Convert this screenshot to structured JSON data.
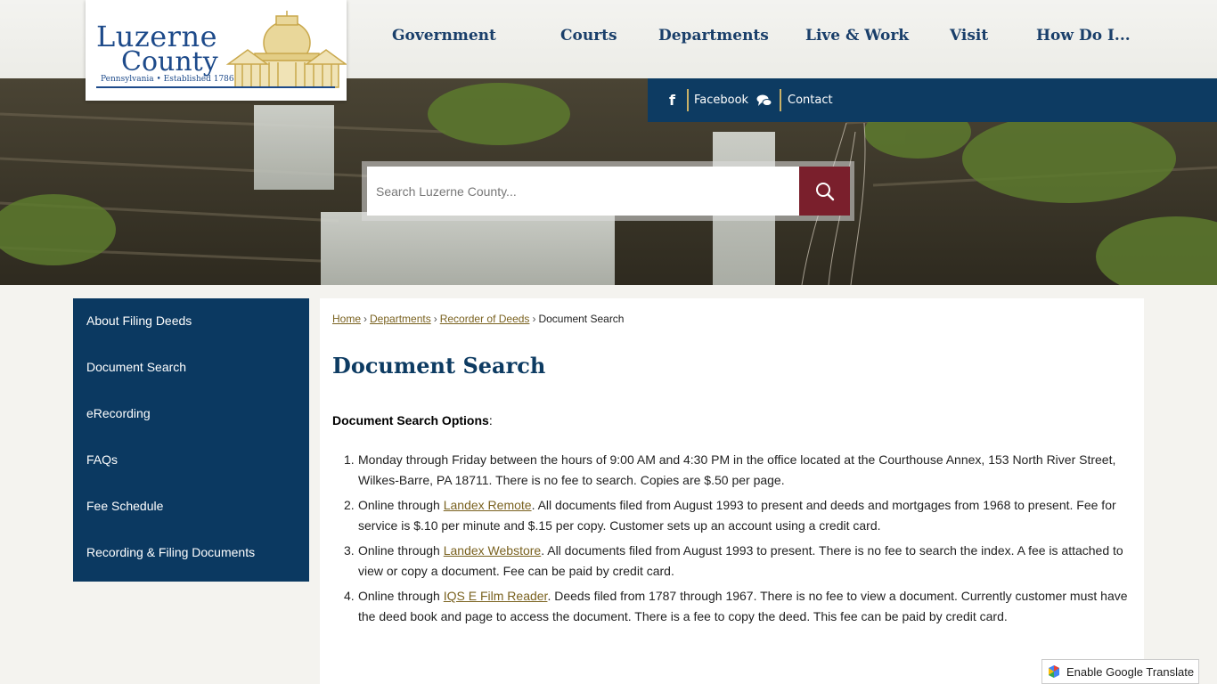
{
  "logo": {
    "line1": "Luzerne",
    "line2": "County",
    "tagline": "Pennsylvania • Established 1786"
  },
  "nav": {
    "items": [
      "Government",
      "Courts",
      "Departments",
      "Live & Work",
      "Visit",
      "How Do I..."
    ]
  },
  "social": {
    "facebook": "Facebook",
    "contact": "Contact",
    "facebook_icon": "facebook-icon",
    "contact_icon": "chat-bubbles-icon"
  },
  "search": {
    "placeholder": "Search Luzerne County...",
    "button_icon": "search-icon"
  },
  "sidebar": {
    "items": [
      {
        "label": "About Filing Deeds"
      },
      {
        "label": "Document Search"
      },
      {
        "label": "eRecording"
      },
      {
        "label": "FAQs"
      },
      {
        "label": "Fee Schedule"
      },
      {
        "label": "Recording & Filing Documents"
      }
    ]
  },
  "breadcrumb": {
    "home": "Home",
    "departments": "Departments",
    "recorder": "Recorder of Deeds",
    "current": "Document Search",
    "separator": "›"
  },
  "main": {
    "title": "Document Search",
    "options_label": "Document Search Options",
    "options_colon": ":",
    "items": [
      {
        "num": "1.",
        "text_before": "Monday through Friday between the hours of 9:00 AM and 4:30 PM in the office located at the Courthouse Annex, 153 North River Street, Wilkes-Barre, PA 18711. There is no fee to search. Copies are $.50 per page.",
        "link": "",
        "text_after": ""
      },
      {
        "num": "2.",
        "text_before": "Online through ",
        "link": "Landex Remote",
        "text_after": ". All documents filed from August 1993 to present and deeds and mortgages from 1968 to present. Fee for  service is $.10 per minute and $.15 per copy. Customer sets up an account using a credit card."
      },
      {
        "num": "3.",
        "text_before": "Online through ",
        "link": "Landex Webstore",
        "text_after": ". All documents filed from August 1993 to present. There is no fee to search the index. A fee is attached to view or copy a document. Fee can be paid by credit card."
      },
      {
        "num": "4.",
        "text_before": "Online through ",
        "link": "IQS E Film Reader",
        "text_after": ". Deeds filed from 1787 through 1967. There is no fee to view a document. Currently customer must have the deed book and page to access the document. There is a fee to copy the deed. This fee can be paid by credit card."
      }
    ]
  },
  "translate": {
    "label": "Enable Google Translate",
    "icon": "google-translate-icon"
  },
  "colors": {
    "navy": "#0b3961",
    "maroon": "#7a1f2c",
    "gold": "#c9b167",
    "link": "#7a6220"
  }
}
